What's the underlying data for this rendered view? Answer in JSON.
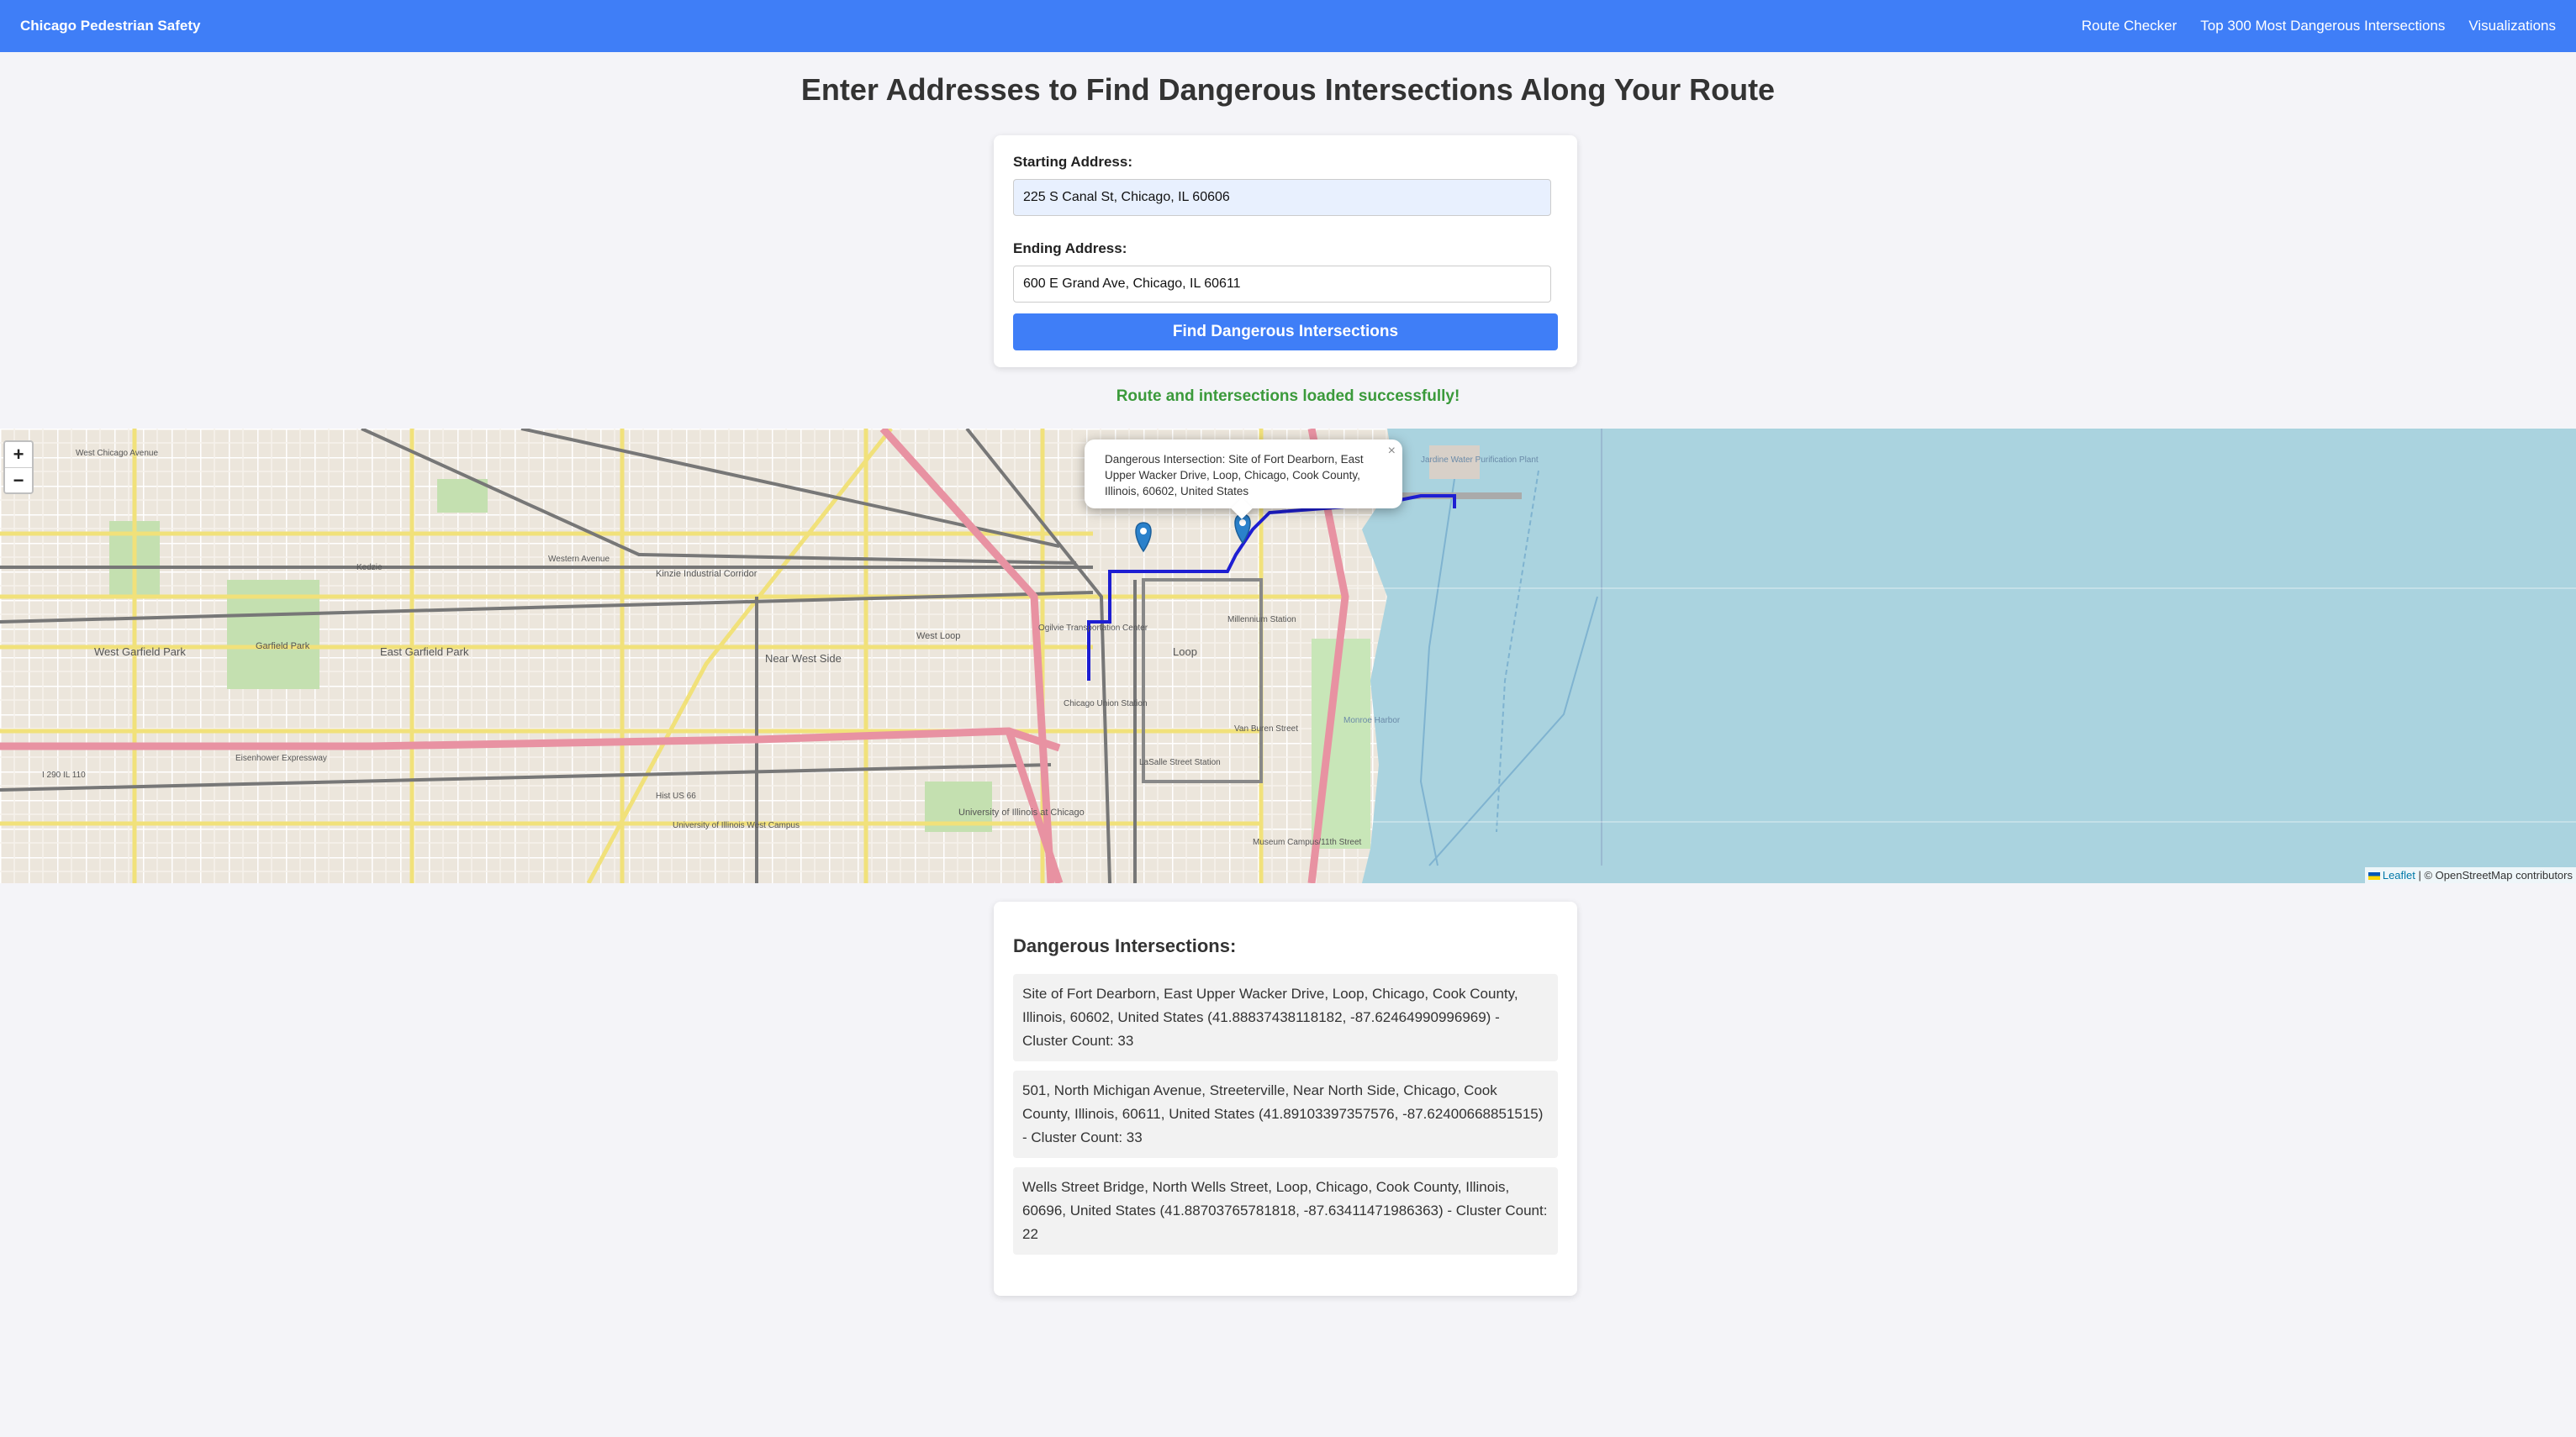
{
  "navbar": {
    "brand": "Chicago Pedestrian Safety",
    "links": [
      "Route Checker",
      "Top 300 Most Dangerous Intersections",
      "Visualizations"
    ]
  },
  "page_title": "Enter Addresses to Find Dangerous Intersections Along Your Route",
  "form": {
    "start_label": "Starting Address:",
    "start_value": "225 S Canal St, Chicago, IL 60606",
    "end_label": "Ending Address:",
    "end_value": "600 E Grand Ave, Chicago, IL 60611",
    "submit_label": "Find Dangerous Intersections"
  },
  "status_message": "Route and intersections loaded successfully!",
  "map": {
    "zoom_in": "+",
    "zoom_out": "−",
    "popup_text": "Dangerous Intersection: Site of Fort Dearborn, East Upper Wacker Drive, Loop, Chicago, Cook County, Illinois, 60602, United States",
    "popup_close": "×",
    "attribution_link": "Leaflet",
    "attribution_rest": " | © OpenStreetMap contributors",
    "labels": {
      "west_chicago_ave": "West Chicago Avenue",
      "kedzie": "Kedzie",
      "western": "Western Avenue",
      "kinzie": "Kinzie Industrial Corridor",
      "west_garfield": "West Garfield Park",
      "garfield": "Garfield Park",
      "east_garfield": "East Garfield Park",
      "near_west": "Near West Side",
      "west_loop": "West Loop",
      "loop": "Loop",
      "millennium": "Millennium Station",
      "ogilvie": "Ogilvie Transportation Center",
      "union": "Chicago Union Station",
      "lasalle": "LaSalle Street Station",
      "van_buren": "Van Buren Street",
      "museum": "Museum Campus/11th Street",
      "uic": "University of Illinois at Chicago",
      "uic_west": "University of Illinois West Campus",
      "i290": "I 290 IL 110",
      "eisenhower": "Eisenhower Expressway",
      "us66": "Hist US 66",
      "monroe": "Monroe Harbor",
      "jardine": "Jardine Water Purification Plant"
    }
  },
  "colors": {
    "navbar": "#3f7ef7",
    "button": "#3f7ef7",
    "success": "#3b9a3b",
    "route": "#1e1ed2",
    "marker": "#2a81cb",
    "water": "#aad3df"
  },
  "results": {
    "title": "Dangerous Intersections:",
    "items": [
      "Site of Fort Dearborn, East Upper Wacker Drive, Loop, Chicago, Cook County, Illinois, 60602, United States (41.88837438118182, -87.62464990996969) - Cluster Count: 33",
      "501, North Michigan Avenue, Streeterville, Near North Side, Chicago, Cook County, Illinois, 60611, United States (41.89103397357576, -87.62400668851515) - Cluster Count: 33",
      "Wells Street Bridge, North Wells Street, Loop, Chicago, Cook County, Illinois, 60696, United States (41.88703765781818, -87.63411471986363) - Cluster Count: 22"
    ]
  }
}
